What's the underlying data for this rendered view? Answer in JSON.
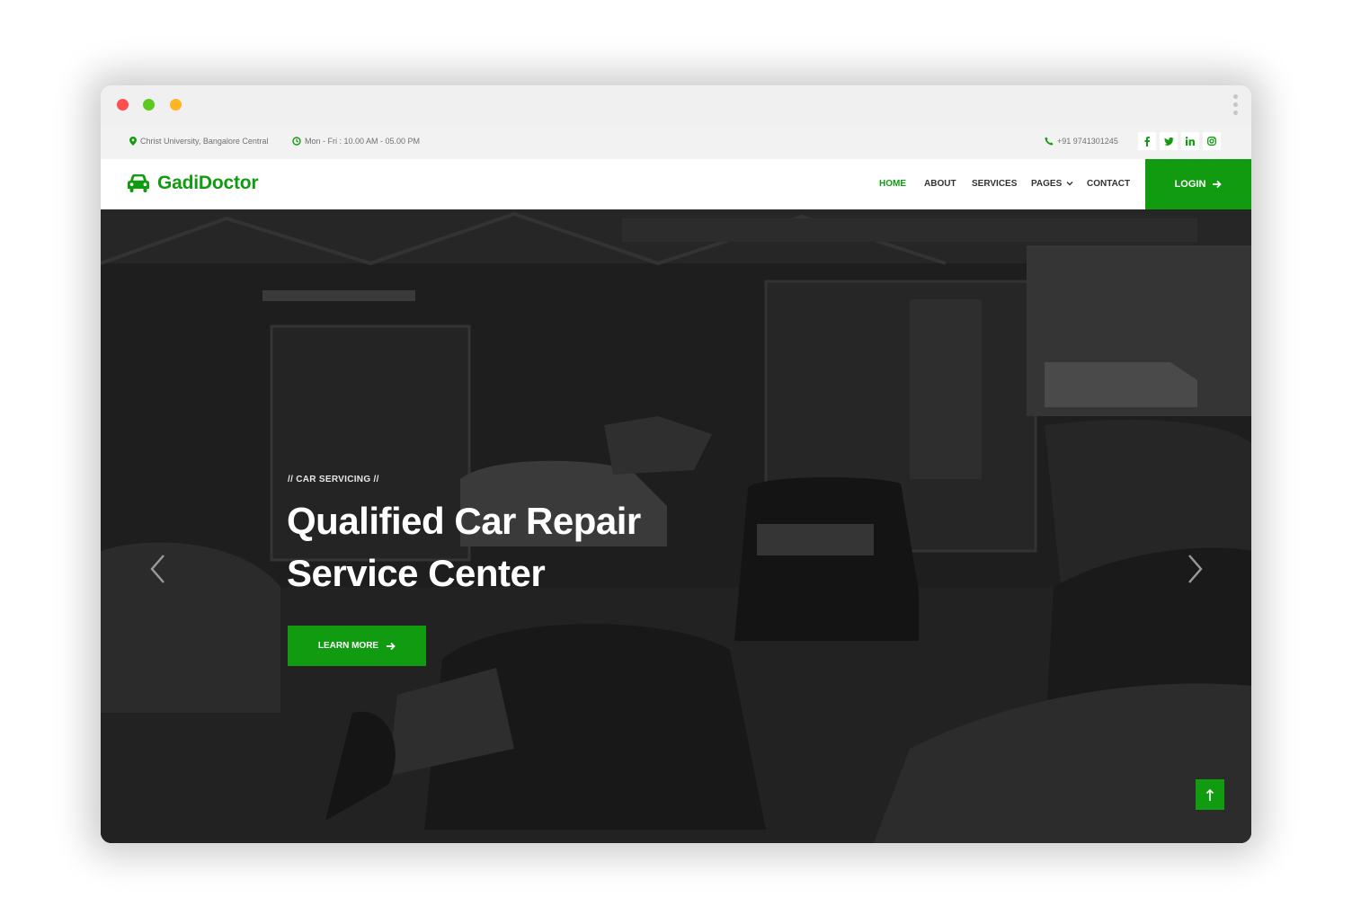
{
  "topbar": {
    "address": "Christ University, Bangalore Central",
    "hours": "Mon - Fri : 10.00 AM - 05.00 PM",
    "phone": "+91 9741301245",
    "socials": [
      "facebook-icon",
      "twitter-icon",
      "linkedin-icon",
      "instagram-icon"
    ]
  },
  "brand": {
    "name": "GadiDoctor",
    "icon": "car-icon",
    "color": "#119b11"
  },
  "nav": {
    "items": [
      "HOME",
      "ABOUT",
      "SERVICES",
      "PAGES",
      "CONTACT"
    ],
    "active": "HOME",
    "login_label": "LOGIN"
  },
  "hero": {
    "eyebrow": "// CAR SERVICING //",
    "title_line1": "Qualified Car Repair",
    "title_line2": "Service Center",
    "cta_label": "LEARN MORE"
  },
  "colors": {
    "accent": "#119b11",
    "hero_overlay": "#1b1b1b"
  }
}
